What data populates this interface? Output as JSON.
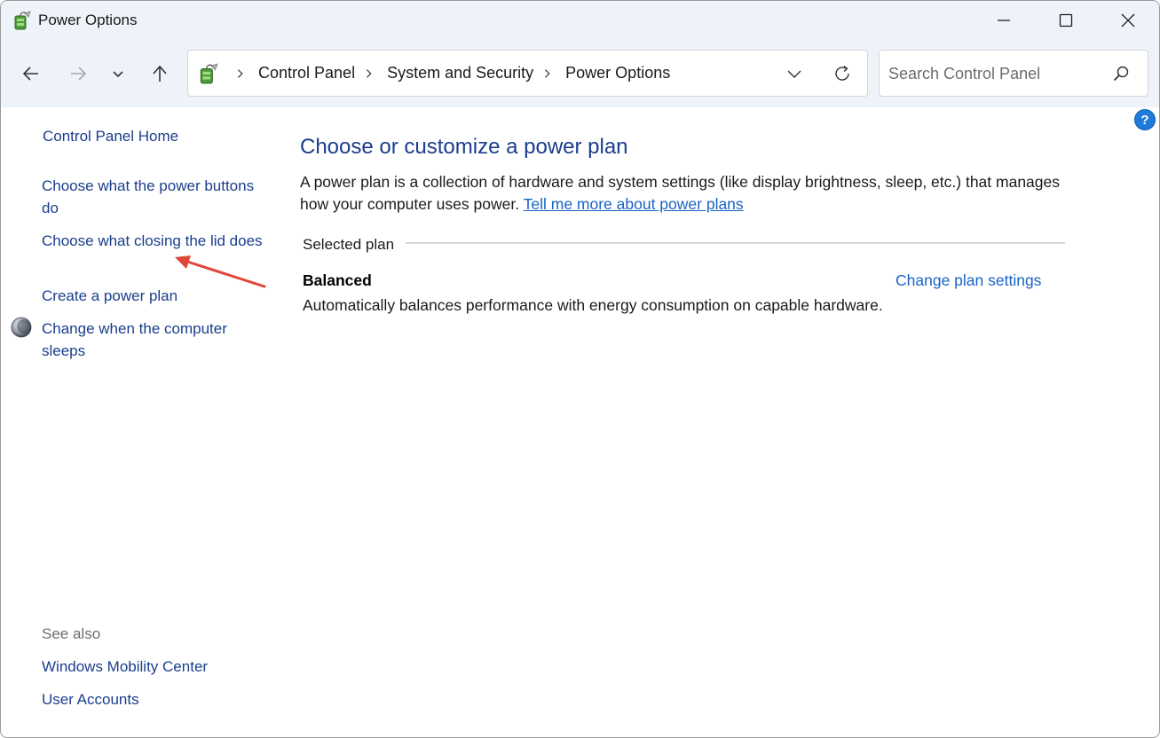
{
  "window": {
    "title": "Power Options"
  },
  "nav": {
    "breadcrumbs": [
      "Control Panel",
      "System and Security",
      "Power Options"
    ],
    "search_placeholder": "Search Control Panel"
  },
  "sidebar": {
    "home": "Control Panel Home",
    "links": [
      "Choose what the power buttons do",
      "Choose what closing the lid does",
      "Create a power plan",
      "Change when the computer sleeps"
    ],
    "see_also_label": "See also",
    "see_also_links": [
      "Windows Mobility Center",
      "User Accounts"
    ]
  },
  "main": {
    "title": "Choose or customize a power plan",
    "description": "A power plan is a collection of hardware and system settings (like display brightness, sleep, etc.) that manages how your computer uses power.",
    "learn_more": "Tell me more about power plans",
    "selected_label": "Selected plan",
    "plan": {
      "name": "Balanced",
      "change_link": "Change plan settings",
      "description": "Automatically balances performance with energy consumption on capable hardware."
    }
  },
  "colors": {
    "link": "#1a3e8c",
    "accent_link": "#1a63c7",
    "chrome": "#eef3fa",
    "annotation_arrow": "#e0463a"
  }
}
